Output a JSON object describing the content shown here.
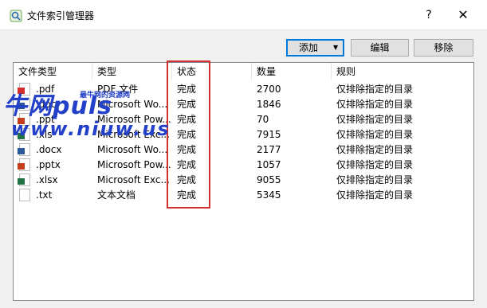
{
  "window": {
    "title": "文件索引管理器",
    "help": "?",
    "close": "✕"
  },
  "toolbar": {
    "add_label": "添加",
    "add_arrow": "▼",
    "edit_label": "编辑",
    "remove_label": "移除"
  },
  "table": {
    "headers": [
      "文件类型",
      "类型",
      "状态",
      "数量",
      "规则"
    ],
    "rows": [
      {
        "ext": ".pdf",
        "type": "PDF 文件",
        "status": "完成",
        "count": "2700",
        "rule": "仅排除指定的目录",
        "icon": "pdf-icon",
        "icon_color": "#d32f2f"
      },
      {
        "ext": ".doc",
        "type": "Microsoft Wo...",
        "status": "完成",
        "count": "1846",
        "rule": "仅排除指定的目录",
        "icon": "word-icon",
        "icon_color": "#2b579a"
      },
      {
        "ext": ".ppt",
        "type": "Microsoft Pow...",
        "status": "完成",
        "count": "70",
        "rule": "仅排除指定的目录",
        "icon": "powerpoint-icon",
        "icon_color": "#c43e1c"
      },
      {
        "ext": ".xls",
        "type": "Microsoft Exc...",
        "status": "完成",
        "count": "7915",
        "rule": "仅排除指定的目录",
        "icon": "excel-icon",
        "icon_color": "#217346"
      },
      {
        "ext": ".docx",
        "type": "Microsoft Wo...",
        "status": "完成",
        "count": "2177",
        "rule": "仅排除指定的目录",
        "icon": "word-icon",
        "icon_color": "#2b579a"
      },
      {
        "ext": ".pptx",
        "type": "Microsoft Pow...",
        "status": "完成",
        "count": "1057",
        "rule": "仅排除指定的目录",
        "icon": "powerpoint-icon",
        "icon_color": "#c43e1c"
      },
      {
        "ext": ".xlsx",
        "type": "Microsoft Exc...",
        "status": "完成",
        "count": "9055",
        "rule": "仅排除指定的目录",
        "icon": "excel-icon",
        "icon_color": "#217346"
      },
      {
        "ext": ".txt",
        "type": "文本文档",
        "status": "完成",
        "count": "5345",
        "rule": "仅排除指定的目录",
        "icon": "text-file-icon",
        "icon_color": "#9e9e9e"
      }
    ]
  },
  "watermark": {
    "brand": "牛网puls",
    "tagline": "最牛网的资源网",
    "url": "www.niuw.us"
  },
  "colors": {
    "accent": "#0078d7",
    "highlight": "#d32f2f",
    "watermark": "#2240c8"
  }
}
